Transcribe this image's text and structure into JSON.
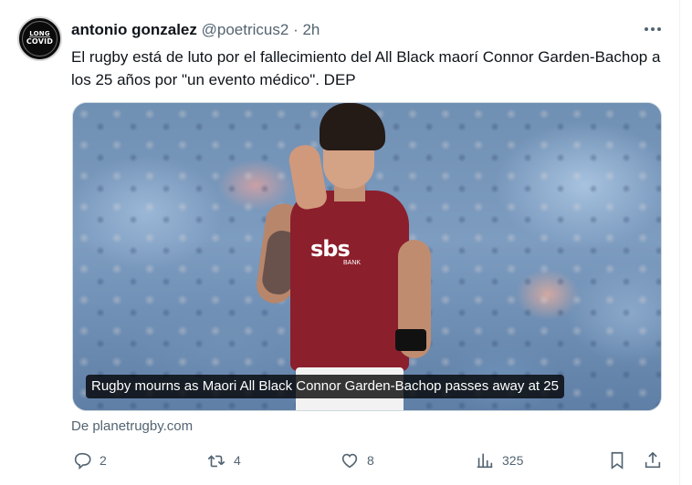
{
  "tweet": {
    "author_name": "antonio gonzalez",
    "handle": "@poetricus2",
    "separator": "·",
    "time": "2h",
    "text": "El rugby está de luto por el fallecimiento del All Black maorí Connor Garden-Bachop a los 25 años por \"un evento médico\". DEP",
    "avatar_text_line1": "LONG",
    "avatar_text_line2": "COVID",
    "more_icon": "more-horizontal-icon"
  },
  "media": {
    "caption": "Rugby mourns as Maori All Black Connor Garden-Bachop passes away at 25",
    "sponsor_text": "sbs",
    "sponsor_sub": "BANK"
  },
  "source": "De planetrugby.com",
  "actions": {
    "reply_count": "2",
    "retweet_count": "4",
    "like_count": "8",
    "views_count": "325"
  },
  "colors": {
    "text": "#0f1419",
    "secondary": "#536471",
    "jersey": "#8c1f2c"
  }
}
